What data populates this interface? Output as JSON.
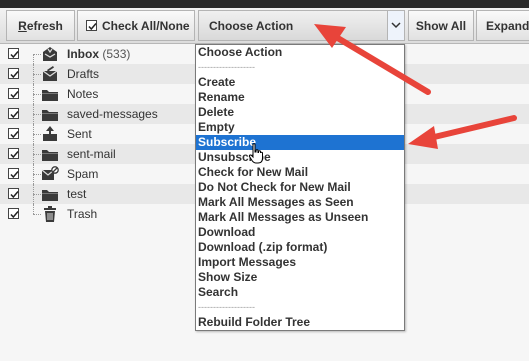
{
  "toolbar": {
    "refresh_prefix": "R",
    "refresh_rest": "efresh",
    "check_all_label": "Check All/None",
    "choose_action_label": "Choose Action",
    "show_all_label": "Show All",
    "expand_label": "Expand"
  },
  "folders": [
    {
      "name": "Inbox",
      "count": "(533)",
      "icon": "inbox-icon",
      "bold": true
    },
    {
      "name": "Drafts",
      "icon": "drafts-envelope-icon"
    },
    {
      "name": "Notes",
      "icon": "folder-icon"
    },
    {
      "name": "saved-messages",
      "icon": "folder-icon"
    },
    {
      "name": "Sent",
      "icon": "sent-tray-icon"
    },
    {
      "name": "sent-mail",
      "icon": "folder-icon"
    },
    {
      "name": "Spam",
      "icon": "spam-envelope-icon"
    },
    {
      "name": "test",
      "icon": "folder-icon"
    },
    {
      "name": "Trash",
      "icon": "trash-icon"
    }
  ],
  "dropdown": {
    "items": [
      "Choose Action",
      "-------------------",
      "Create",
      "Rename",
      "Delete",
      "Empty",
      "Subscribe",
      "Unsubscribe",
      "Check for New Mail",
      "Do Not Check for New Mail",
      "Mark All Messages as Seen",
      "Mark All Messages as Unseen",
      "Download",
      "Download (.zip format)",
      "Import Messages",
      "Show Size",
      "Search",
      "-------------------",
      "Rebuild Folder Tree"
    ],
    "highlighted": "Subscribe"
  },
  "colors": {
    "highlight": "#1e73d2",
    "annotation_arrow": "#e8443a"
  }
}
